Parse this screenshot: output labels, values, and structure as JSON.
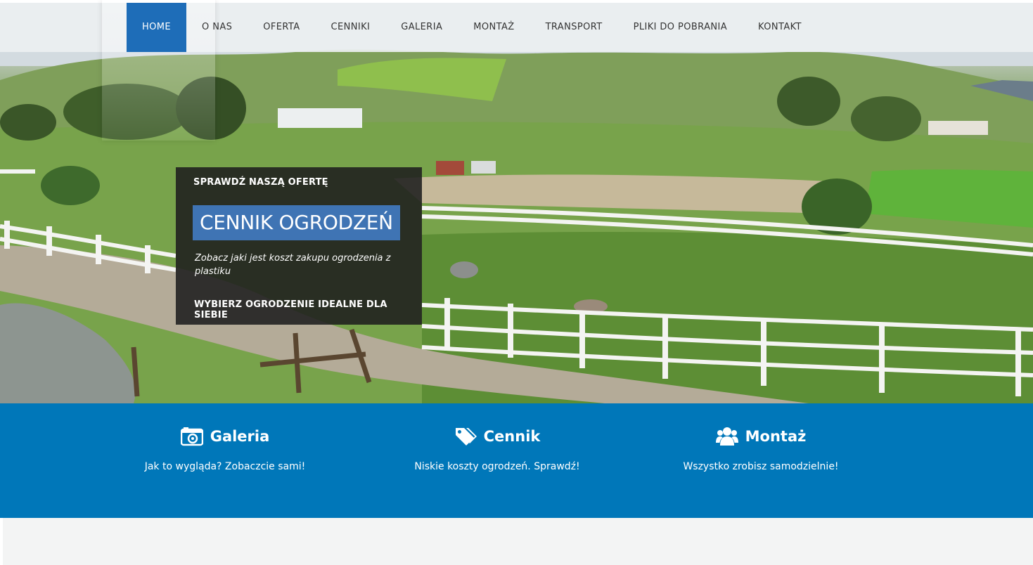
{
  "nav": {
    "items": [
      {
        "label": "HOME",
        "active": true
      },
      {
        "label": "O NAS"
      },
      {
        "label": "OFERTA"
      },
      {
        "label": "CENNIKI"
      },
      {
        "label": "GALERIA"
      },
      {
        "label": "MONTAŻ"
      },
      {
        "label": "TRANSPORT"
      },
      {
        "label": "PLIKI DO POBRANIA"
      },
      {
        "label": "KONTAKT"
      }
    ]
  },
  "promo": {
    "kicker": "SPRAWDŹ NASZĄ OFERTĘ",
    "title": "CENNIK OGRODZEŃ",
    "description": "Zobacz jaki jest koszt zakupu ogrodzenia z plastiku",
    "cta": "WYBIERZ OGRODZENIE IDEALNE DLA SIEBIE"
  },
  "features": [
    {
      "title": "Galeria",
      "text": "Jak to wygląda? Zobaczcie sami!",
      "icon": "camera-icon"
    },
    {
      "title": "Cennik",
      "text": "Niskie koszty ogrodzeń. Sprawdź!",
      "icon": "tags-icon"
    },
    {
      "title": "Montaż",
      "text": "Wszystko zrobisz samodzielnie!",
      "icon": "users-icon"
    }
  ],
  "colors": {
    "nav_active": "#1e6db8",
    "features_bg": "#0077b9",
    "promo_title_bg": "#3f74b4",
    "promo_bg": "#1e1e1e"
  }
}
